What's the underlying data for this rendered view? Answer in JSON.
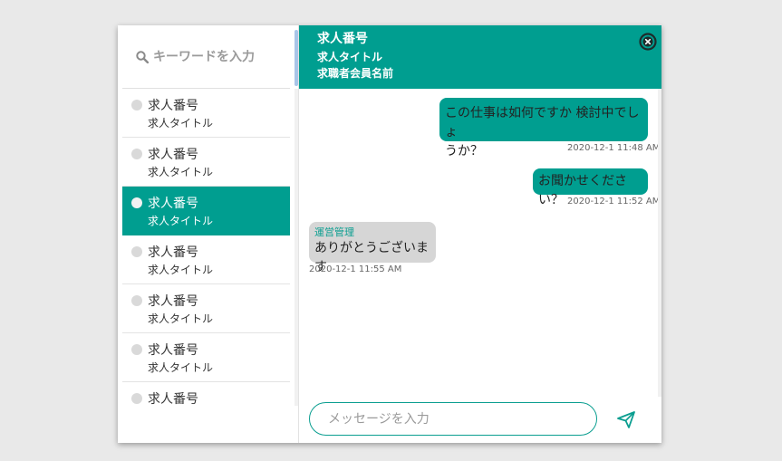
{
  "search": {
    "placeholder": "キーワードを入力"
  },
  "conversations": [
    {
      "number": "求人番号",
      "title": "求人タイトル",
      "active": false
    },
    {
      "number": "求人番号",
      "title": "求人タイトル",
      "active": false
    },
    {
      "number": "求人番号",
      "title": "求人タイトル",
      "active": true
    },
    {
      "number": "求人番号",
      "title": "求人タイトル",
      "active": false
    },
    {
      "number": "求人番号",
      "title": "求人タイトル",
      "active": false
    },
    {
      "number": "求人番号",
      "title": "求人タイトル",
      "active": false
    },
    {
      "number": "求人番号",
      "title": "",
      "active": false
    }
  ],
  "header": {
    "number": "求人番号",
    "title": "求人タイトル",
    "applicant": "求職者会員名前"
  },
  "messages": [
    {
      "direction": "out",
      "text_line1": "この仕事は如何ですか 検討中でしょ",
      "text_line2": "うか？",
      "timestamp": "2020-12-1 11:48 AM"
    },
    {
      "direction": "out",
      "text": "お聞かせください？",
      "timestamp": "2020-12-1 11:52 AM"
    },
    {
      "direction": "in",
      "sender": "運営管理",
      "text": "ありがとうございます",
      "timestamp": "2020-12-1 11:55 AM"
    }
  ],
  "composer": {
    "placeholder": "メッセージを入力"
  },
  "colors": {
    "accent": "#009e90",
    "incoming_bubble": "#d6d6d6",
    "background": "#e9e9e9"
  },
  "icons": {
    "search": "magnifier-icon",
    "close": "close-circle-icon",
    "send": "paper-plane-icon"
  }
}
